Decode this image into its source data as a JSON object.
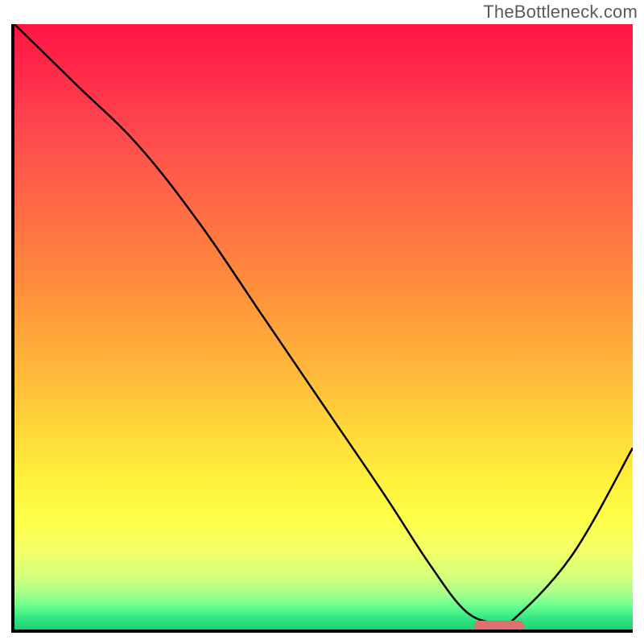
{
  "watermark": "TheBottleneck.com",
  "colors": {
    "axis": "#000000",
    "curve": "#000000",
    "marker": "#e07070"
  },
  "chart_data": {
    "type": "line",
    "title": "",
    "xlabel": "",
    "ylabel": "",
    "xlim": [
      0,
      100
    ],
    "ylim": [
      0,
      100
    ],
    "series": [
      {
        "name": "bottleneck-curve",
        "x": [
          0,
          10,
          20,
          30,
          40,
          50,
          60,
          67,
          73,
          78,
          80,
          90,
          100
        ],
        "values": [
          100,
          90,
          80,
          67,
          52,
          37,
          22,
          11,
          3,
          1,
          1,
          12,
          30
        ]
      }
    ],
    "annotations": [
      {
        "name": "optimal-range-marker",
        "x_start": 74,
        "x_end": 82,
        "y": 1
      }
    ],
    "gradient_stops": [
      {
        "pct": 0,
        "color": "#ff1444"
      },
      {
        "pct": 50,
        "color": "#ffb13a"
      },
      {
        "pct": 80,
        "color": "#fdff4a"
      },
      {
        "pct": 100,
        "color": "#1ed070"
      }
    ]
  }
}
